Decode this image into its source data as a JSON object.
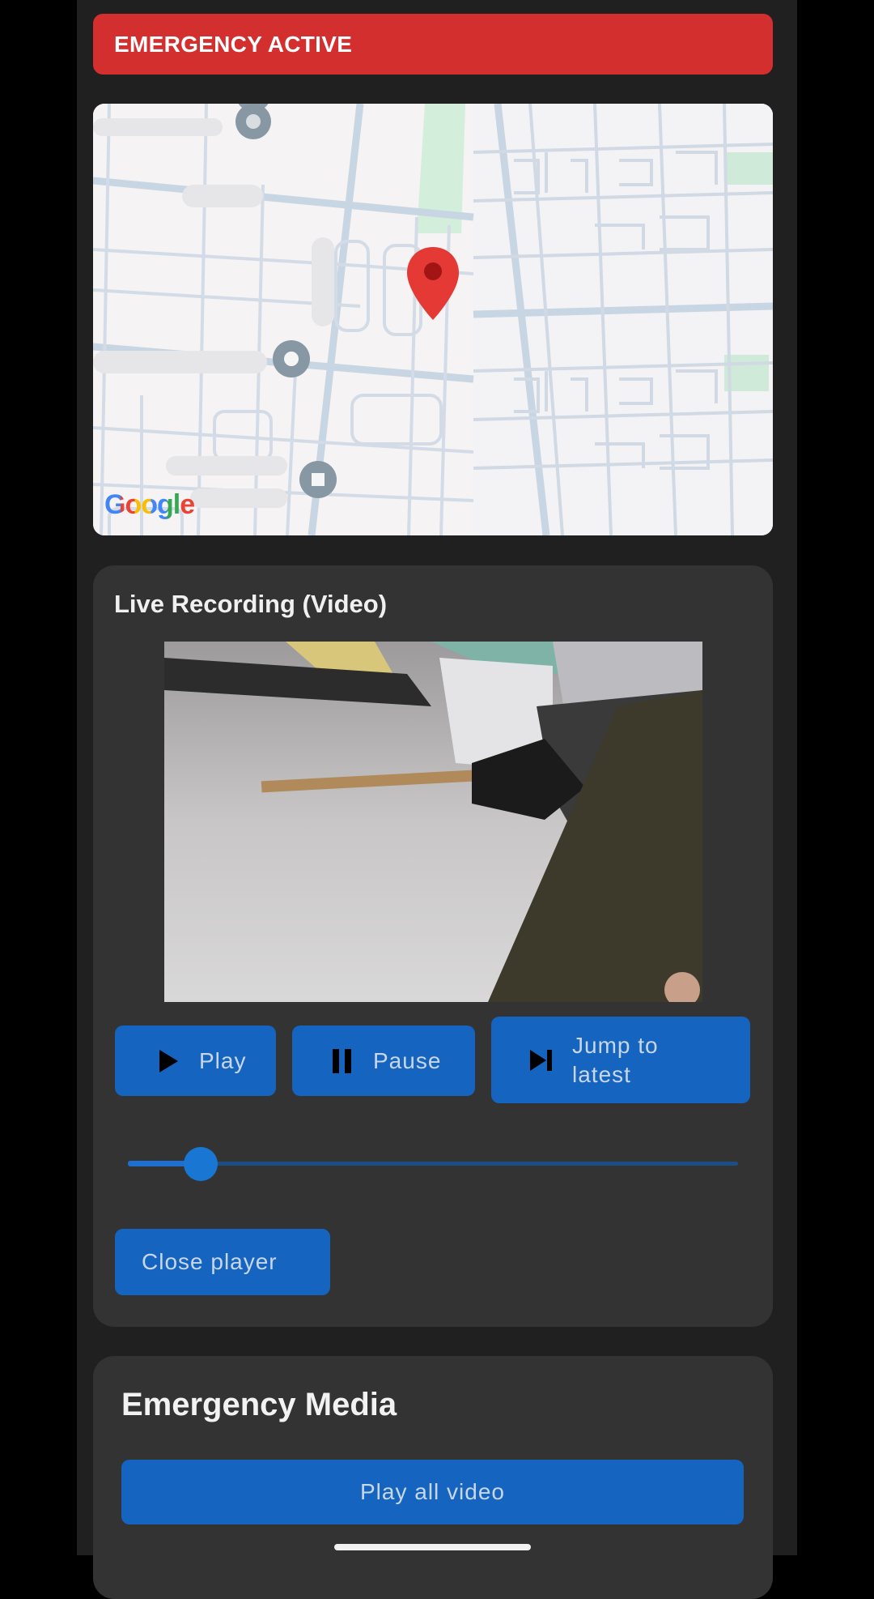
{
  "banner": {
    "text": "EMERGENCY ACTIVE",
    "color": "#d32f2f"
  },
  "map": {
    "attribution": "Google",
    "pin_color": "#e53935"
  },
  "live_recording": {
    "title": "Live Recording (Video)",
    "buttons": {
      "play": {
        "label": "Play",
        "icon": "play-icon"
      },
      "pause": {
        "label": "Pause",
        "icon": "pause-icon"
      },
      "jump": {
        "label_line1": "Jump to",
        "label_line2": "latest",
        "icon": "skip-next-icon"
      }
    },
    "seek_progress": 0.12,
    "close_label": "Close player"
  },
  "emergency_media": {
    "title": "Emergency Media",
    "play_all_label": "Play all video"
  },
  "colors": {
    "accent": "#1565c0",
    "card_bg": "#333333",
    "screen_bg": "#202020"
  }
}
